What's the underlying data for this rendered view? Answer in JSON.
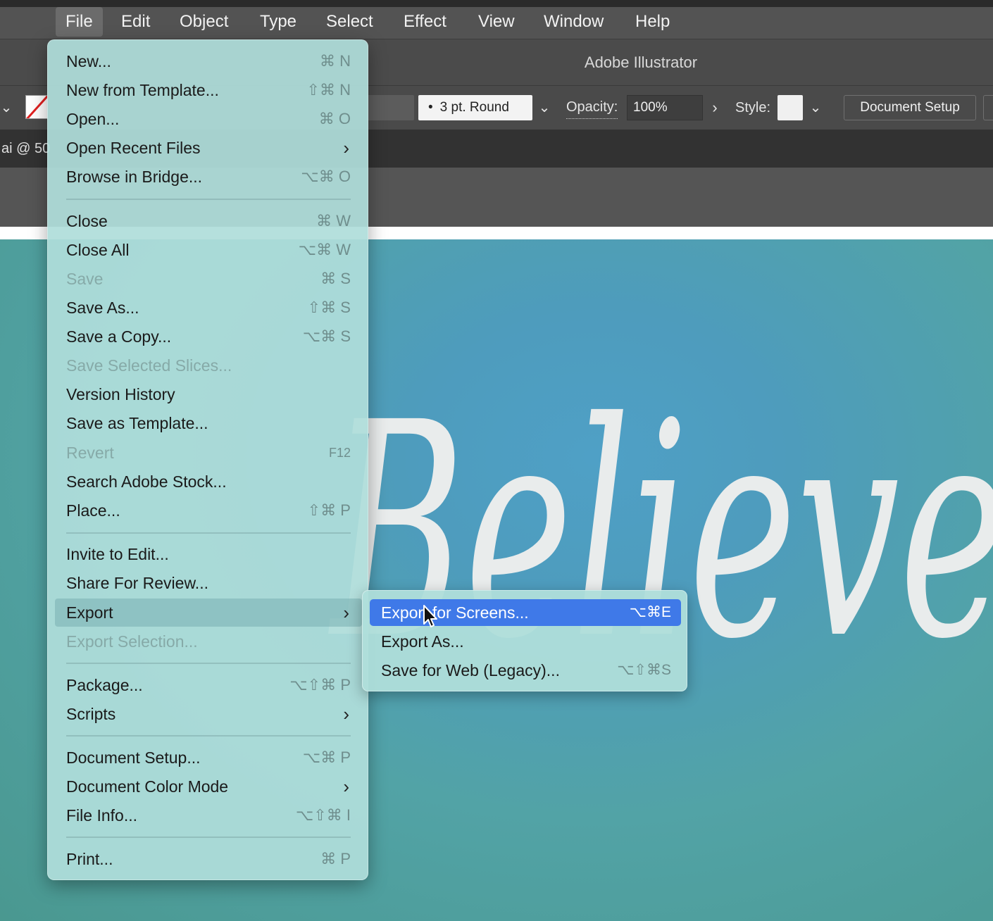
{
  "menubar": {
    "items": [
      {
        "label": "File"
      },
      {
        "label": "Edit"
      },
      {
        "label": "Object"
      },
      {
        "label": "Type"
      },
      {
        "label": "Select"
      },
      {
        "label": "Effect"
      },
      {
        "label": "View"
      },
      {
        "label": "Window"
      },
      {
        "label": "Help"
      }
    ]
  },
  "window": {
    "title": "Adobe Illustrator"
  },
  "controlbar": {
    "brush": "3 pt. Round",
    "opacity_label": "Opacity:",
    "opacity_value": "100%",
    "style_label": "Style:",
    "document_setup": "Document Setup"
  },
  "document_tab": {
    "label": "ai @ 50"
  },
  "canvas": {
    "artwork_text": "Believe"
  },
  "file_menu": {
    "items": [
      {
        "label": "New...",
        "shortcut": "⌘ N"
      },
      {
        "label": "New from Template...",
        "shortcut": "⇧⌘ N"
      },
      {
        "label": "Open...",
        "shortcut": "⌘ O"
      },
      {
        "label": "Open Recent Files",
        "submenu": true
      },
      {
        "label": "Browse in Bridge...",
        "shortcut": "⌥⌘ O"
      },
      {
        "label": "Close",
        "shortcut": "⌘ W"
      },
      {
        "label": "Close All",
        "shortcut": "⌥⌘ W"
      },
      {
        "label": "Save",
        "shortcut": "⌘ S",
        "disabled": true
      },
      {
        "label": "Save As...",
        "shortcut": "⇧⌘ S"
      },
      {
        "label": "Save a Copy...",
        "shortcut": "⌥⌘ S"
      },
      {
        "label": "Save Selected Slices...",
        "disabled": true
      },
      {
        "label": "Version History"
      },
      {
        "label": "Save as Template..."
      },
      {
        "label": "Revert",
        "shortcut": "F12",
        "disabled": true
      },
      {
        "label": "Search Adobe Stock..."
      },
      {
        "label": "Place...",
        "shortcut": "⇧⌘ P"
      },
      {
        "label": "Invite to Edit..."
      },
      {
        "label": "Share For Review..."
      },
      {
        "label": "Export",
        "submenu": true,
        "highlighted": true
      },
      {
        "label": "Export Selection...",
        "disabled": true
      },
      {
        "label": "Package...",
        "shortcut": "⌥⇧⌘ P"
      },
      {
        "label": "Scripts",
        "submenu": true
      },
      {
        "label": "Document Setup...",
        "shortcut": "⌥⌘ P"
      },
      {
        "label": "Document Color Mode",
        "submenu": true
      },
      {
        "label": "File Info...",
        "shortcut": "⌥⇧⌘ I"
      },
      {
        "label": "Print...",
        "shortcut": "⌘ P"
      }
    ]
  },
  "export_submenu": {
    "items": [
      {
        "label": "Export for Screens...",
        "shortcut": "⌥⌘E",
        "selected": true
      },
      {
        "label": "Export As..."
      },
      {
        "label": "Save for Web (Legacy)...",
        "shortcut": "⌥⇧⌘S"
      }
    ]
  },
  "colors": {
    "menubar": "#535353",
    "menu_bg": "#afdeda",
    "selection": "#3f79e8",
    "canvas": "#4e9cbd"
  }
}
